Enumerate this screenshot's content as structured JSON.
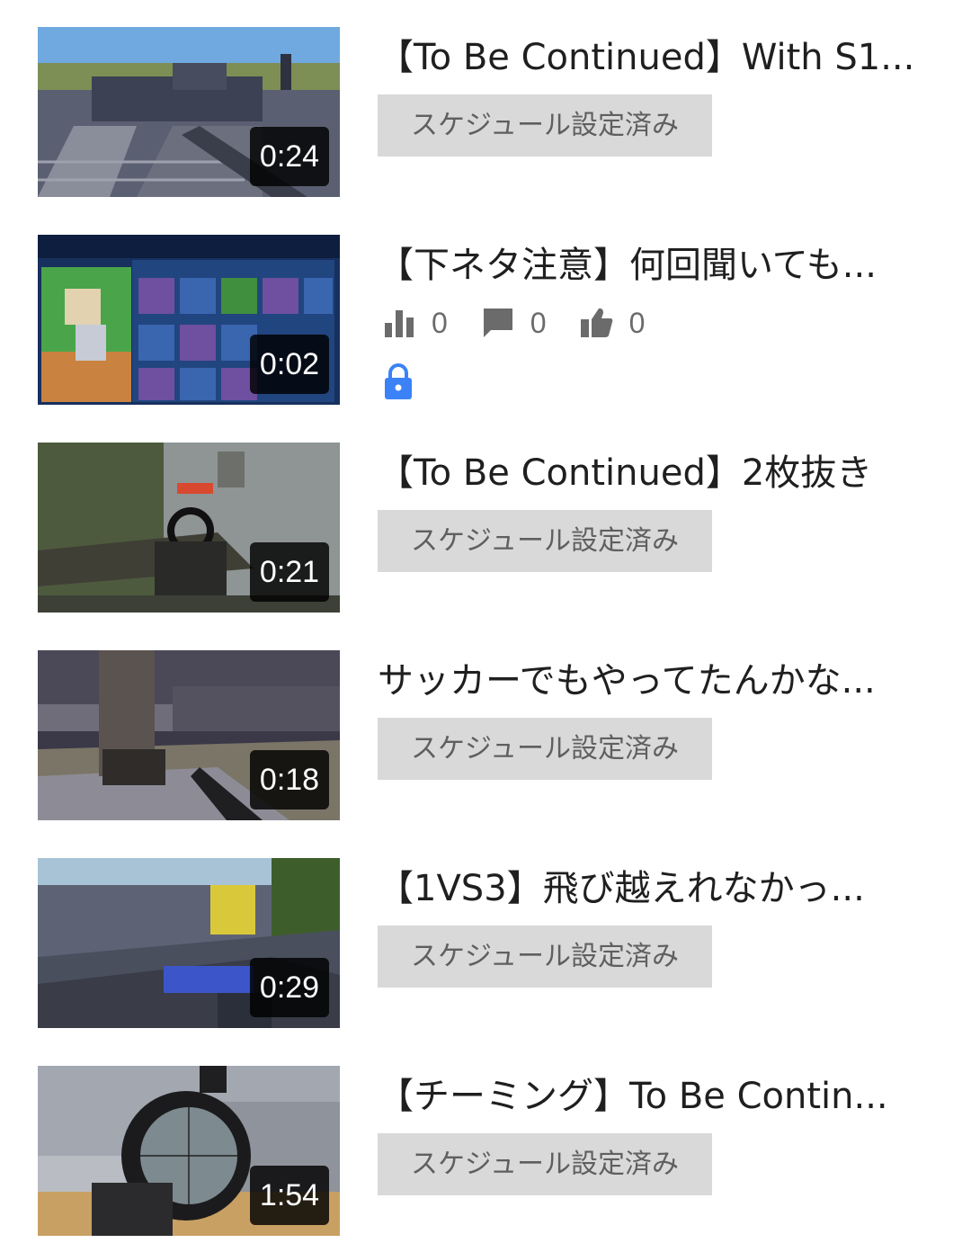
{
  "videos": [
    {
      "title": "【To Be Continued】With S1...",
      "duration": "0:24",
      "status": "スケジュール設定済み"
    },
    {
      "title": "【下ネタ注意】何回聞いても...",
      "duration": "0:02",
      "stats": {
        "views": "0",
        "comments": "0",
        "likes": "0"
      },
      "visibility_icon": "lock-icon"
    },
    {
      "title": "【To Be Continued】2枚抜き",
      "duration": "0:21",
      "status": "スケジュール設定済み"
    },
    {
      "title": "サッカーでもやってたんかな...",
      "duration": "0:18",
      "status": "スケジュール設定済み"
    },
    {
      "title": "【1VS3】飛び越えれなかっ...",
      "duration": "0:29",
      "status": "スケジュール設定済み"
    },
    {
      "title": "【チーミング】To Be Contin...",
      "duration": "1:54",
      "status": "スケジュール設定済み"
    }
  ],
  "colors": {
    "status_badge_bg": "#d9d9d9",
    "lock_icon": "#3b82f6",
    "stat_icon": "#6b6b6b"
  }
}
